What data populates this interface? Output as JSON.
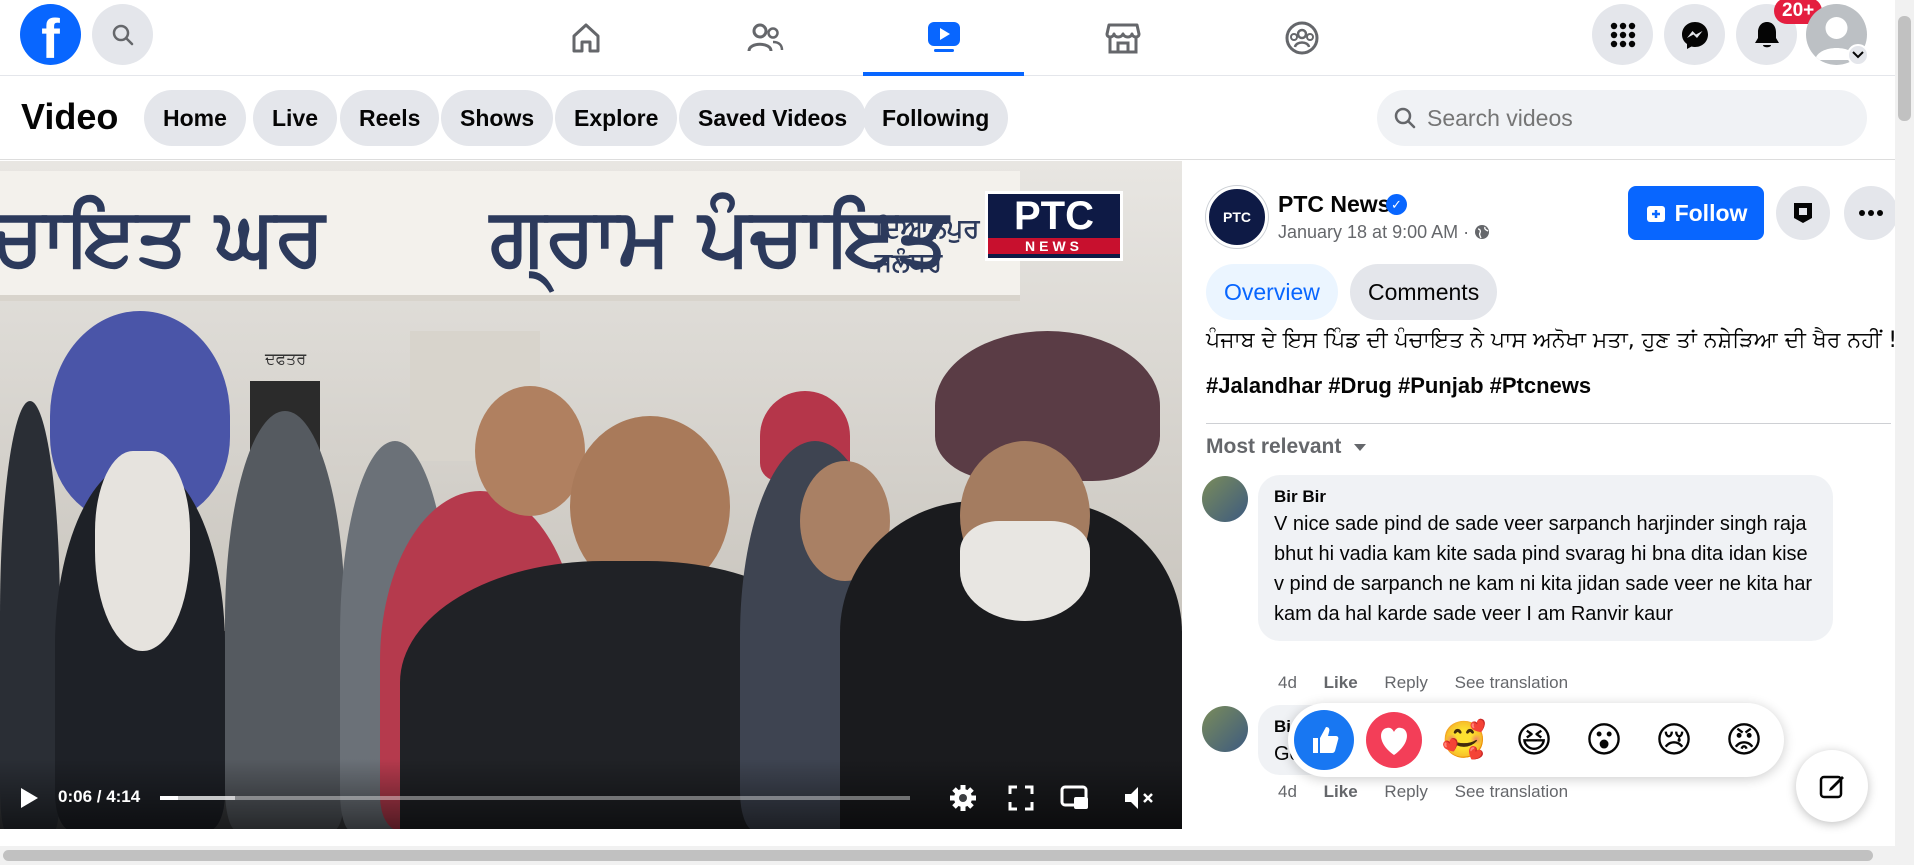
{
  "topnav": {
    "logo": "f",
    "notification_count": "20+",
    "icons": [
      "facebook-logo-icon",
      "search-icon",
      "home-icon",
      "friends-icon",
      "watch-icon",
      "marketplace-icon",
      "groups-icon",
      "menu-grid-icon",
      "messenger-icon",
      "bell-icon"
    ]
  },
  "video_header": {
    "title": "Video",
    "pills": [
      "Home",
      "Live",
      "Reels",
      "Shows",
      "Explore",
      "Saved Videos",
      "Following"
    ],
    "search_placeholder": "Search videos"
  },
  "player": {
    "sign_line1": "ਚਾਇਤ ਘਰ",
    "sign_line2": "ਗ੍ਰਾਮ ਪੰਚਾਇਤ",
    "sign_small": "ਦਿਆਲਪੁਰ ਜਲੰਧਰ",
    "office_label": "ਦਫਤਰ",
    "logo_top": "PTC",
    "logo_bottom": "NEWS",
    "time": "0:06 / 4:14",
    "played_fraction": 0.024,
    "buffered_fraction": 0.1
  },
  "post": {
    "page_name": "PTC News",
    "page_avatar": "PTC",
    "date": "January 18 at 9:00 AM ·",
    "follow_label": "Follow",
    "tabs": [
      "Overview",
      "Comments"
    ],
    "caption": "ਪੰਜਾਬ ਦੇ ਇਸ ਪਿੰਡ ਦੀ ਪੰਚਾਇਤ ਨੇ ਪਾਸ ਅਨੋਖਾ ਮਤਾ, ਹੁਣ ਤਾਂ ਨਸ਼ੇੜਿਆ ਦੀ ਖੈਰ ਨਹੀਂ !",
    "hashtags": "#Jalandhar #Drug #Punjab #Ptcnews",
    "sort_label": "Most relevant"
  },
  "comments": [
    {
      "name": "Bir Bir",
      "text": "V nice sade pind de sade veer sarpanch harjinder singh raja bhut hi vadia kam kite sada pind svarag hi bna dita idan kise v pind de sarpanch ne kam ni kita jidan sade veer ne kita har kam da hal karde sade veer I am Ranvir kaur",
      "time": "4d",
      "like": "Like",
      "reply": "Reply",
      "translate": "See translation"
    },
    {
      "name": "Bi",
      "text": "Go",
      "time": "4d",
      "like": "Like",
      "reply": "Reply",
      "translate": "See translation"
    }
  ],
  "reactions": [
    "👍",
    "❤️",
    "🥰",
    "😆",
    "😮",
    "😢",
    "😡"
  ]
}
